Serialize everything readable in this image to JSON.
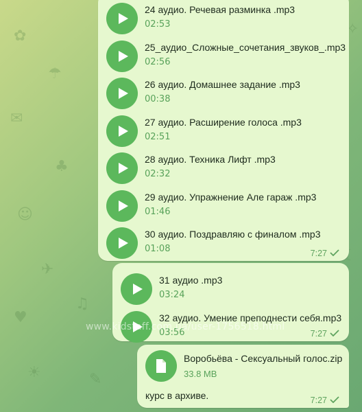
{
  "colors": {
    "bubble": "#e6f8cf",
    "accent": "#5cb85c",
    "meta": "#5fa35f"
  },
  "group1": {
    "tracks": [
      {
        "name": "24 аудио. Речевая разминка .mp3",
        "duration": "02:53"
      },
      {
        "name": "25_аудио_Сложные_сочетания_звуков_.mp3",
        "duration": "02:56"
      },
      {
        "name": "26 аудио. Домашнее задание .mp3",
        "duration": "00:38"
      },
      {
        "name": "27 аудио. Расширение голоса .mp3",
        "duration": "02:51"
      },
      {
        "name": "28 аудио. Техника Лифт .mp3",
        "duration": "02:32"
      },
      {
        "name": "29 аудио. Упражнение Але гараж .mp3",
        "duration": "01:46"
      },
      {
        "name": "30 аудио. Поздравляю с финалом .mp3",
        "duration": "01:08"
      }
    ],
    "time": "7:27"
  },
  "group2": {
    "tracks": [
      {
        "name": "31 аудио .mp3",
        "duration": "03:24"
      },
      {
        "name": "32 аудио. Умение преподнести себя.mp3",
        "duration": "03:56"
      }
    ],
    "time": "7:27"
  },
  "file_message": {
    "file_name": "Воробьёва - Сексуальный голос.zip",
    "file_size": "33.8 MB",
    "caption": "курс в архиве.",
    "time": "7:27"
  },
  "watermark": "www.kidstaff.com.ua/user-1756518.html"
}
